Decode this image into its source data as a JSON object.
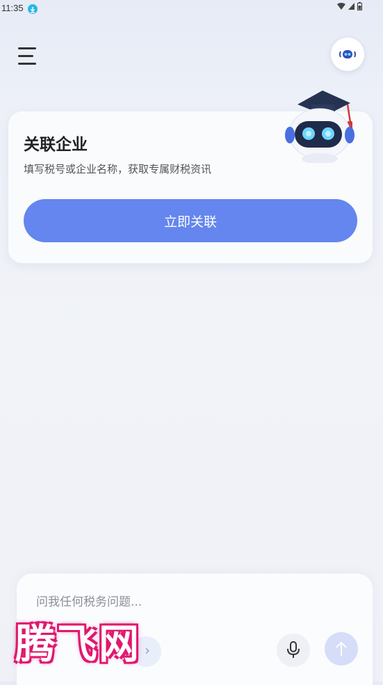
{
  "status_bar": {
    "time": "11:35",
    "icons": [
      "download-icon",
      "wifi-icon",
      "signal-icon",
      "battery-icon"
    ]
  },
  "header": {
    "menu_icon": "menu-icon",
    "assistant_icon": "assistant-icon"
  },
  "card": {
    "title": "关联企业",
    "subtitle": "填写税号或企业名称，获取专属财税资讯",
    "button_label": "立即关联",
    "button_color": "#6486ee",
    "mascot": "robot-mascot-graduation-cap"
  },
  "composer": {
    "placeholder": "问我任何税务问题...",
    "mic_icon": "microphone-icon",
    "send_icon": "send-arrow-icon"
  },
  "watermark": {
    "text": "腾飞网",
    "color": "#e0186f"
  }
}
